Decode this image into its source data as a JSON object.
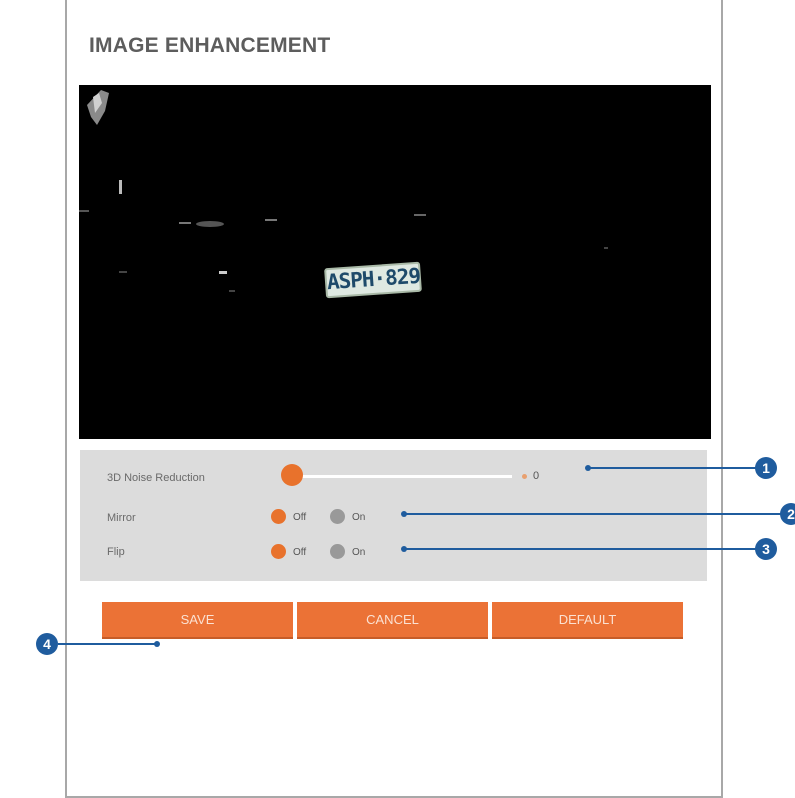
{
  "title": "IMAGE ENHANCEMENT",
  "video": {
    "plate_text": "ASPH·829"
  },
  "settings": {
    "noise_reduction": {
      "label": "3D Noise Reduction",
      "value": "0",
      "level_fraction": 0.0
    },
    "mirror": {
      "label": "Mirror",
      "options": [
        "Off",
        "On"
      ],
      "selected": "Off"
    },
    "flip": {
      "label": "Flip",
      "options": [
        "Off",
        "On"
      ],
      "selected": "Off"
    }
  },
  "buttons": {
    "save": "SAVE",
    "cancel": "CANCEL",
    "default": "DEFAULT"
  },
  "callouts": [
    "1",
    "2",
    "3",
    "4"
  ],
  "colors": {
    "accent": "#eb7236",
    "callout": "#1f5c9e",
    "settings_bg": "#dcdcdc",
    "radio_unselected": "#999999"
  }
}
